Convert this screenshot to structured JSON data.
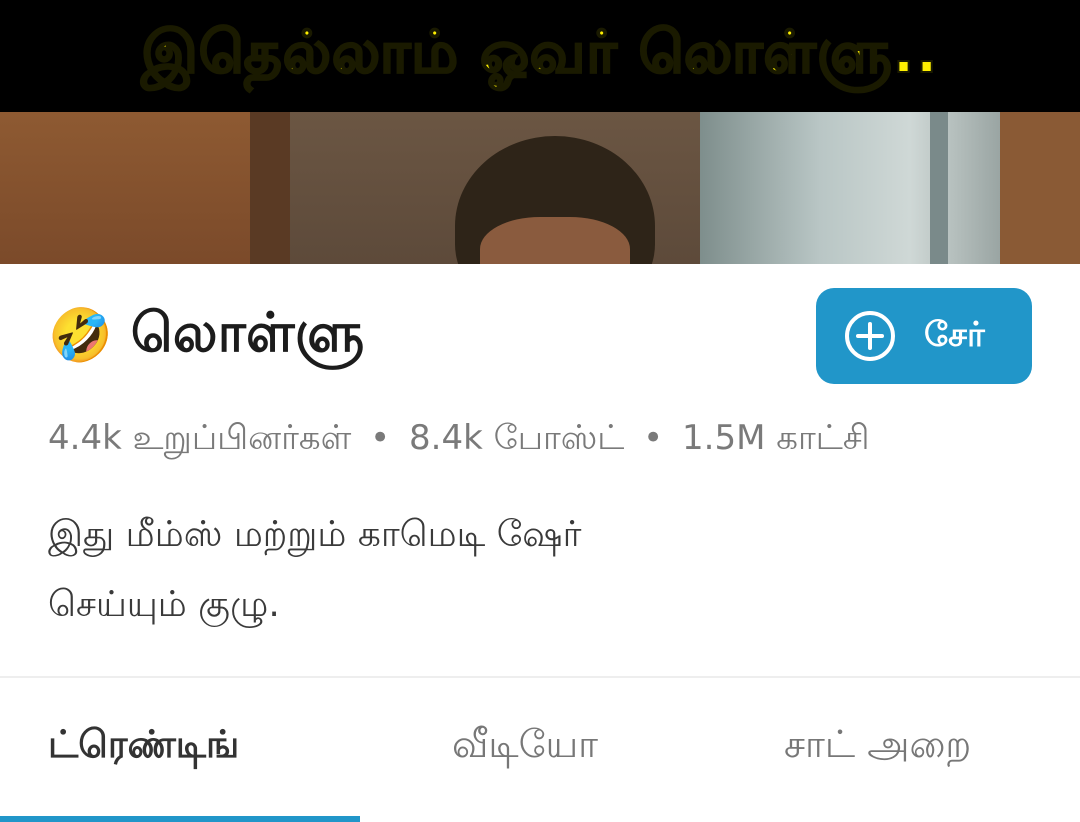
{
  "banner": {
    "caption": "இதெல்லாம் ஓவர் லொள்ளு.."
  },
  "group": {
    "emoji": "🤣",
    "name": "லொள்ளு",
    "join_label": "சேர்",
    "stats": {
      "members": "4.4k உறுப்பினர்கள்",
      "posts": "8.4k போஸ்ட்",
      "views": "1.5M காட்சி",
      "separator": "•"
    },
    "description_line1": "இது மீம்ஸ் மற்றும் காமெடி ஷேர்",
    "description_line2": "செய்யும் குழு."
  },
  "tabs": [
    {
      "label": "ட்ரெண்டிங்",
      "active": true
    },
    {
      "label": "வீடியோ",
      "active": false
    },
    {
      "label": "சாட் அறை",
      "active": false
    }
  ],
  "colors": {
    "accent": "#2196c9",
    "caption_text": "#fff000",
    "caption_bg": "#000000"
  },
  "icons": {
    "join": "plus-circle-icon"
  }
}
